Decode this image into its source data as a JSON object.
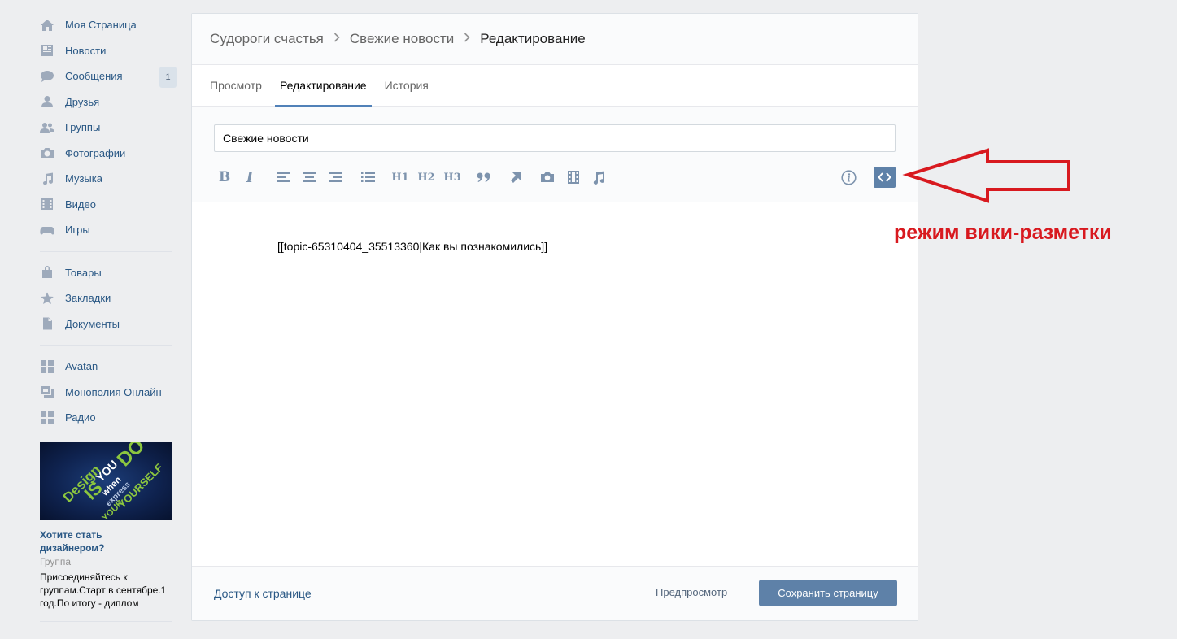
{
  "sidebar": {
    "items": [
      {
        "label": "Моя Страница",
        "icon": "home-icon"
      },
      {
        "label": "Новости",
        "icon": "news-icon"
      },
      {
        "label": "Сообщения",
        "icon": "messages-icon",
        "badge": "1"
      },
      {
        "label": "Друзья",
        "icon": "friends-icon"
      },
      {
        "label": "Группы",
        "icon": "groups-icon"
      },
      {
        "label": "Фотографии",
        "icon": "camera-icon"
      },
      {
        "label": "Музыка",
        "icon": "music-icon"
      },
      {
        "label": "Видео",
        "icon": "video-icon"
      },
      {
        "label": "Игры",
        "icon": "gamepad-icon"
      }
    ],
    "items2": [
      {
        "label": "Товары",
        "icon": "shopping-bag-icon"
      },
      {
        "label": "Закладки",
        "icon": "star-icon"
      },
      {
        "label": "Документы",
        "icon": "document-icon"
      }
    ],
    "apps": [
      {
        "label": "Avatan",
        "icon": "app-grid-icon"
      },
      {
        "label": "Монополия Онлайн",
        "icon": "app-image-icon"
      },
      {
        "label": "Радио",
        "icon": "app-grid-icon"
      }
    ],
    "ad": {
      "title": "Хотите стать дизайнером?",
      "type": "Группа",
      "text": "Присоединяйтесь к группам.Старт в сентябре.1 год.По итогу - диплом",
      "image_words": [
        "Design",
        "IS",
        "YOU",
        "DO",
        "when",
        "express",
        "YOUR",
        "YOURSELF"
      ]
    }
  },
  "breadcrumb": {
    "items": [
      "Судороги счастья",
      "Свежие новости",
      "Редактирование"
    ]
  },
  "tabs": [
    {
      "label": "Просмотр",
      "active": false
    },
    {
      "label": "Редактирование",
      "active": true
    },
    {
      "label": "История",
      "active": false
    }
  ],
  "editor": {
    "title_value": "Свежие новости",
    "toolbar": {
      "bold": "B",
      "italic": "I",
      "h1": "H1",
      "h2": "H2",
      "h3": "H3"
    },
    "content": "[[topic-65310404_35513360|Как вы познакомились]]"
  },
  "footer": {
    "access_label": "Доступ к странице",
    "preview_label": "Предпросмотр",
    "save_label": "Сохранить страницу"
  },
  "annotation": {
    "label": "режим вики-разметки",
    "color": "#d8191f"
  },
  "colors": {
    "accent": "#5181b8",
    "button": "#5e81a8",
    "link": "#2a5885",
    "background": "#edeef0"
  }
}
